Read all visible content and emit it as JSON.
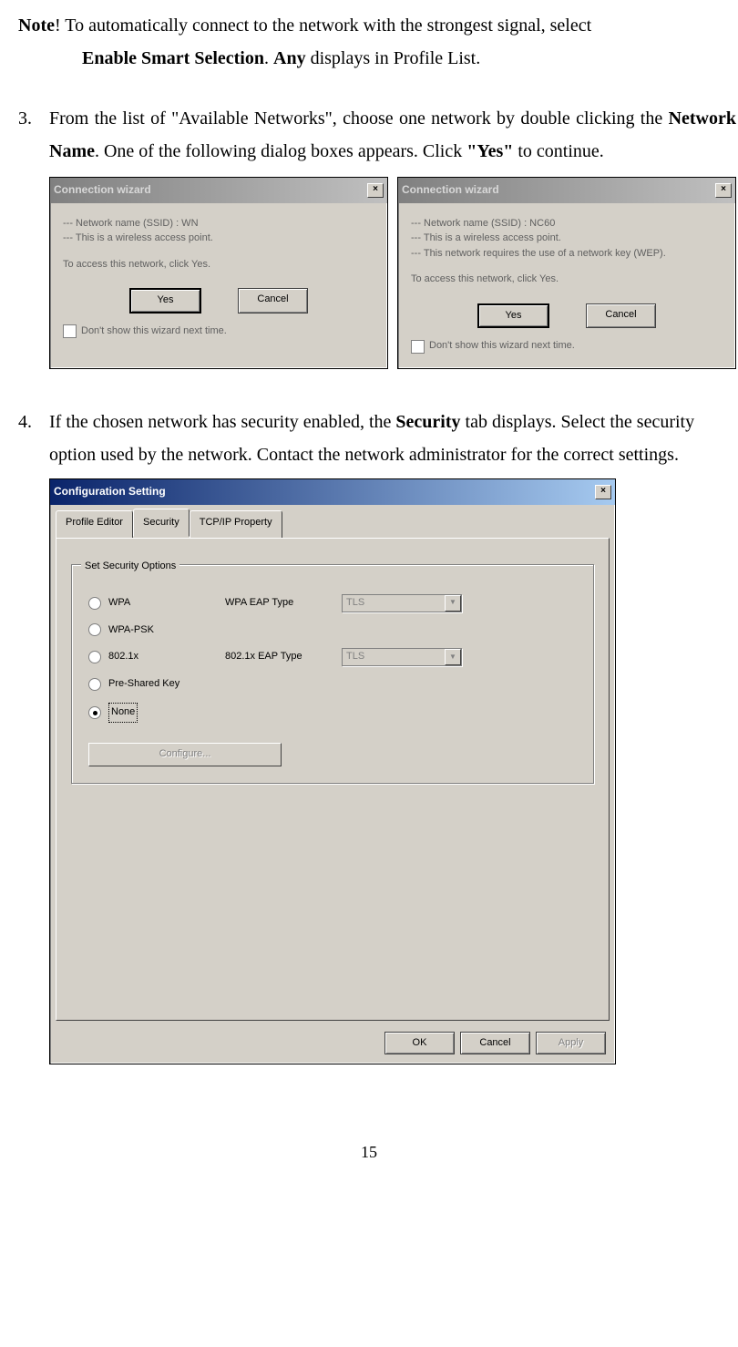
{
  "note": {
    "label": "Note",
    "line1_a": "! To automatically connect to the network with the strongest signal, select",
    "line2_bold": "Enable Smart Selection",
    "line2_mid": ". ",
    "line2_bold2": "Any",
    "line2_end": " displays in Profile List."
  },
  "step3": {
    "num": "3.",
    "a": "From the list of \"Available Networks\", choose one network by double clicking the ",
    "bold1": "Network Name",
    "b": ".  One of the following dialog boxes appears.  Click ",
    "bold2": "\"Yes\"",
    "c": " to continue."
  },
  "wizard1": {
    "title": "Connection wizard",
    "l1": "--- Network name (SSID) : WN",
    "l2": "--- This is a wireless access point.",
    "prompt": "To access this network, click Yes.",
    "yes": "Yes",
    "cancel": "Cancel",
    "chk": "Don't show this wizard next time."
  },
  "wizard2": {
    "title": "Connection wizard",
    "l1": "--- Network name (SSID) : NC60",
    "l2": "--- This is a wireless access point.",
    "l3": "--- This network requires the use of a network key (WEP).",
    "prompt": "To access this network, click Yes.",
    "yes": "Yes",
    "cancel": "Cancel",
    "chk": "Don't show this wizard next time."
  },
  "step4": {
    "num": "4.",
    "a": "If the chosen network has security enabled, the ",
    "bold1": "Security",
    "b": " tab displays. Select the security option used by the network. Contact the network administrator for the correct settings."
  },
  "config": {
    "title": "Configuration Setting",
    "tabs": [
      "Profile Editor",
      "Security",
      "TCP/IP Property"
    ],
    "group_label": "Set Security Options",
    "opts": {
      "wpa": "WPA",
      "wpa_psk": "WPA-PSK",
      "dot1x": "802.1x",
      "psk": "Pre-Shared Key",
      "none": "None"
    },
    "eap1_label": "WPA EAP Type",
    "eap1_val": "TLS",
    "eap2_label": "802.1x EAP Type",
    "eap2_val": "TLS",
    "configure": "Configure...",
    "ok": "OK",
    "cancel": "Cancel",
    "apply": "Apply"
  },
  "page_num": "15"
}
